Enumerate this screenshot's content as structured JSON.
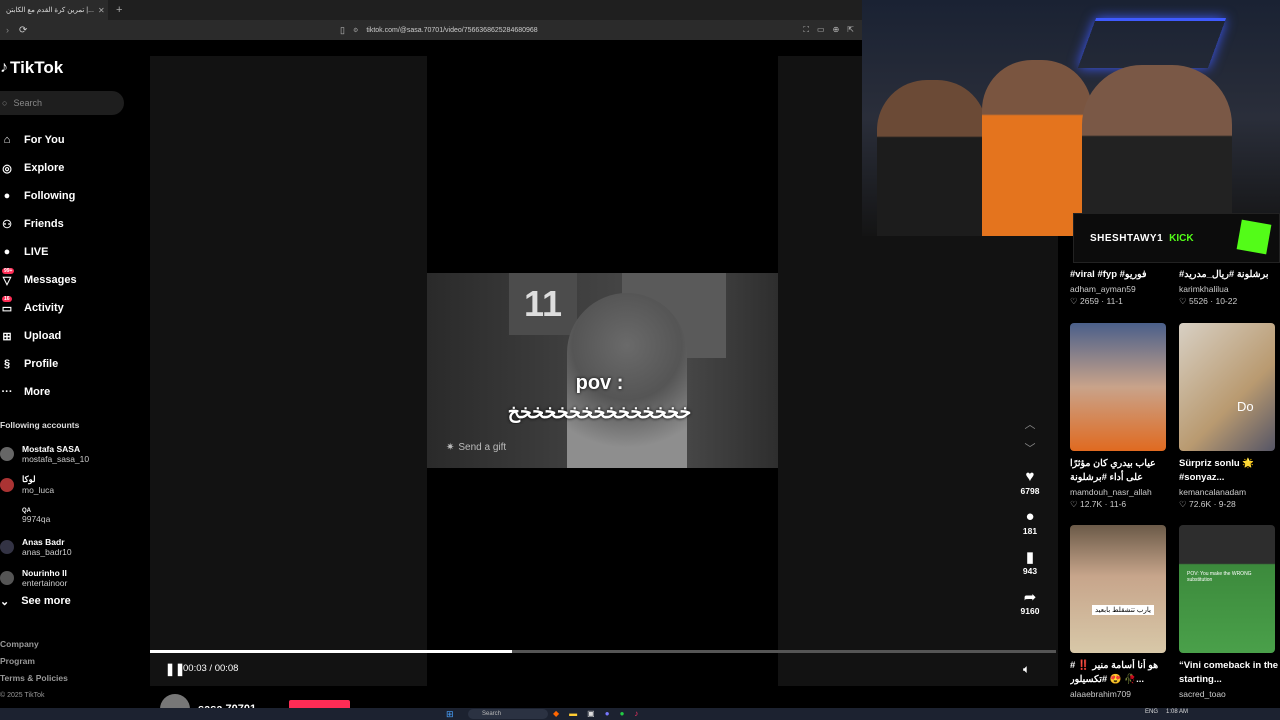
{
  "browser": {
    "tab_title": "تمرين كرة القدم مع الكابتن |...",
    "tab_close": "✕",
    "new_tab": "+",
    "url": "tiktok.com/@sasa.70701/video/7566368625284680968"
  },
  "sidebar": {
    "logo": "TikTok",
    "search_placeholder": "Search",
    "nav": [
      {
        "label": "For You",
        "icon": "home-icon"
      },
      {
        "label": "Explore",
        "icon": "compass-icon"
      },
      {
        "label": "Following",
        "icon": "following-icon"
      },
      {
        "label": "Friends",
        "icon": "friends-icon"
      },
      {
        "label": "LIVE",
        "icon": "live-icon"
      },
      {
        "label": "Messages",
        "icon": "message-icon",
        "badge": "99+"
      },
      {
        "label": "Activity",
        "icon": "inbox-icon",
        "badge": "16"
      },
      {
        "label": "Upload",
        "icon": "upload-icon"
      },
      {
        "label": "Profile",
        "icon": "profile-icon"
      },
      {
        "label": "More",
        "icon": "more-icon"
      }
    ],
    "following_title": "Following accounts",
    "following": [
      {
        "name": "Mostafa SASA",
        "handle": "mostafa_sasa_10"
      },
      {
        "name": "لوكا",
        "handle": "mo_luca"
      },
      {
        "name": "QA",
        "handle": "9974qa"
      },
      {
        "name": "Anas Badr",
        "handle": "anas_badr10"
      },
      {
        "name": "Nourinho II",
        "handle": "entertainoor"
      }
    ],
    "see_more": "See more",
    "footer": [
      "Company",
      "Program",
      "Terms & Policies"
    ],
    "copyright": "© 2025 TikTok"
  },
  "video": {
    "overlay_title": "pov :",
    "overlay_text": "خخخخخخخخخخخخخخخ",
    "shirt_number": "11",
    "gift_label": "Send a gift",
    "time": "00:03 / 00:08",
    "progress": 0.4,
    "author": "sasa.70701"
  },
  "actions": {
    "likes": "6798",
    "comments": "181",
    "saves": "943",
    "shares": "9160"
  },
  "overlay": {
    "streamer": "SHESHTAWY1",
    "platform": "KICK"
  },
  "suggestions": {
    "top": [
      {
        "caption": "#viral #fyp #فوريو",
        "user": "adham_ayman59",
        "likes": "2659",
        "date": "11-1"
      },
      {
        "caption": "#برشلونة #ريال_مدريد",
        "user": "karimkhalilua",
        "likes": "5526",
        "date": "10-22"
      }
    ],
    "cards": [
      {
        "caption": "عياب بيدري كان مؤثرًا على أداء #برشلونة",
        "user": "mamdouh_nasr_allah",
        "likes": "12.7K",
        "date": "11-6"
      },
      {
        "caption": "Sürpriz sonlu 🌟 #sonyaz...",
        "user": "kemancalanadam",
        "likes": "72.6K",
        "date": "9-28",
        "thumb_label": "Do"
      },
      {
        "caption": "هو أنا أسامة منير ‼️ # #تكسيلور 😍 🥀...",
        "user": "alaaebrahim709",
        "likes": "",
        "date": "",
        "thumb_label": "يارب تتشقلط بابعيد"
      },
      {
        "caption": "“Vini comeback in the starting...",
        "user": "sacred_toao",
        "likes": "",
        "date": "",
        "thumb_label": "POV: You make the WRONG substitution"
      }
    ]
  },
  "taskbar": {
    "search": "Search",
    "lang": "ENG",
    "clock": "1:08 AM"
  }
}
